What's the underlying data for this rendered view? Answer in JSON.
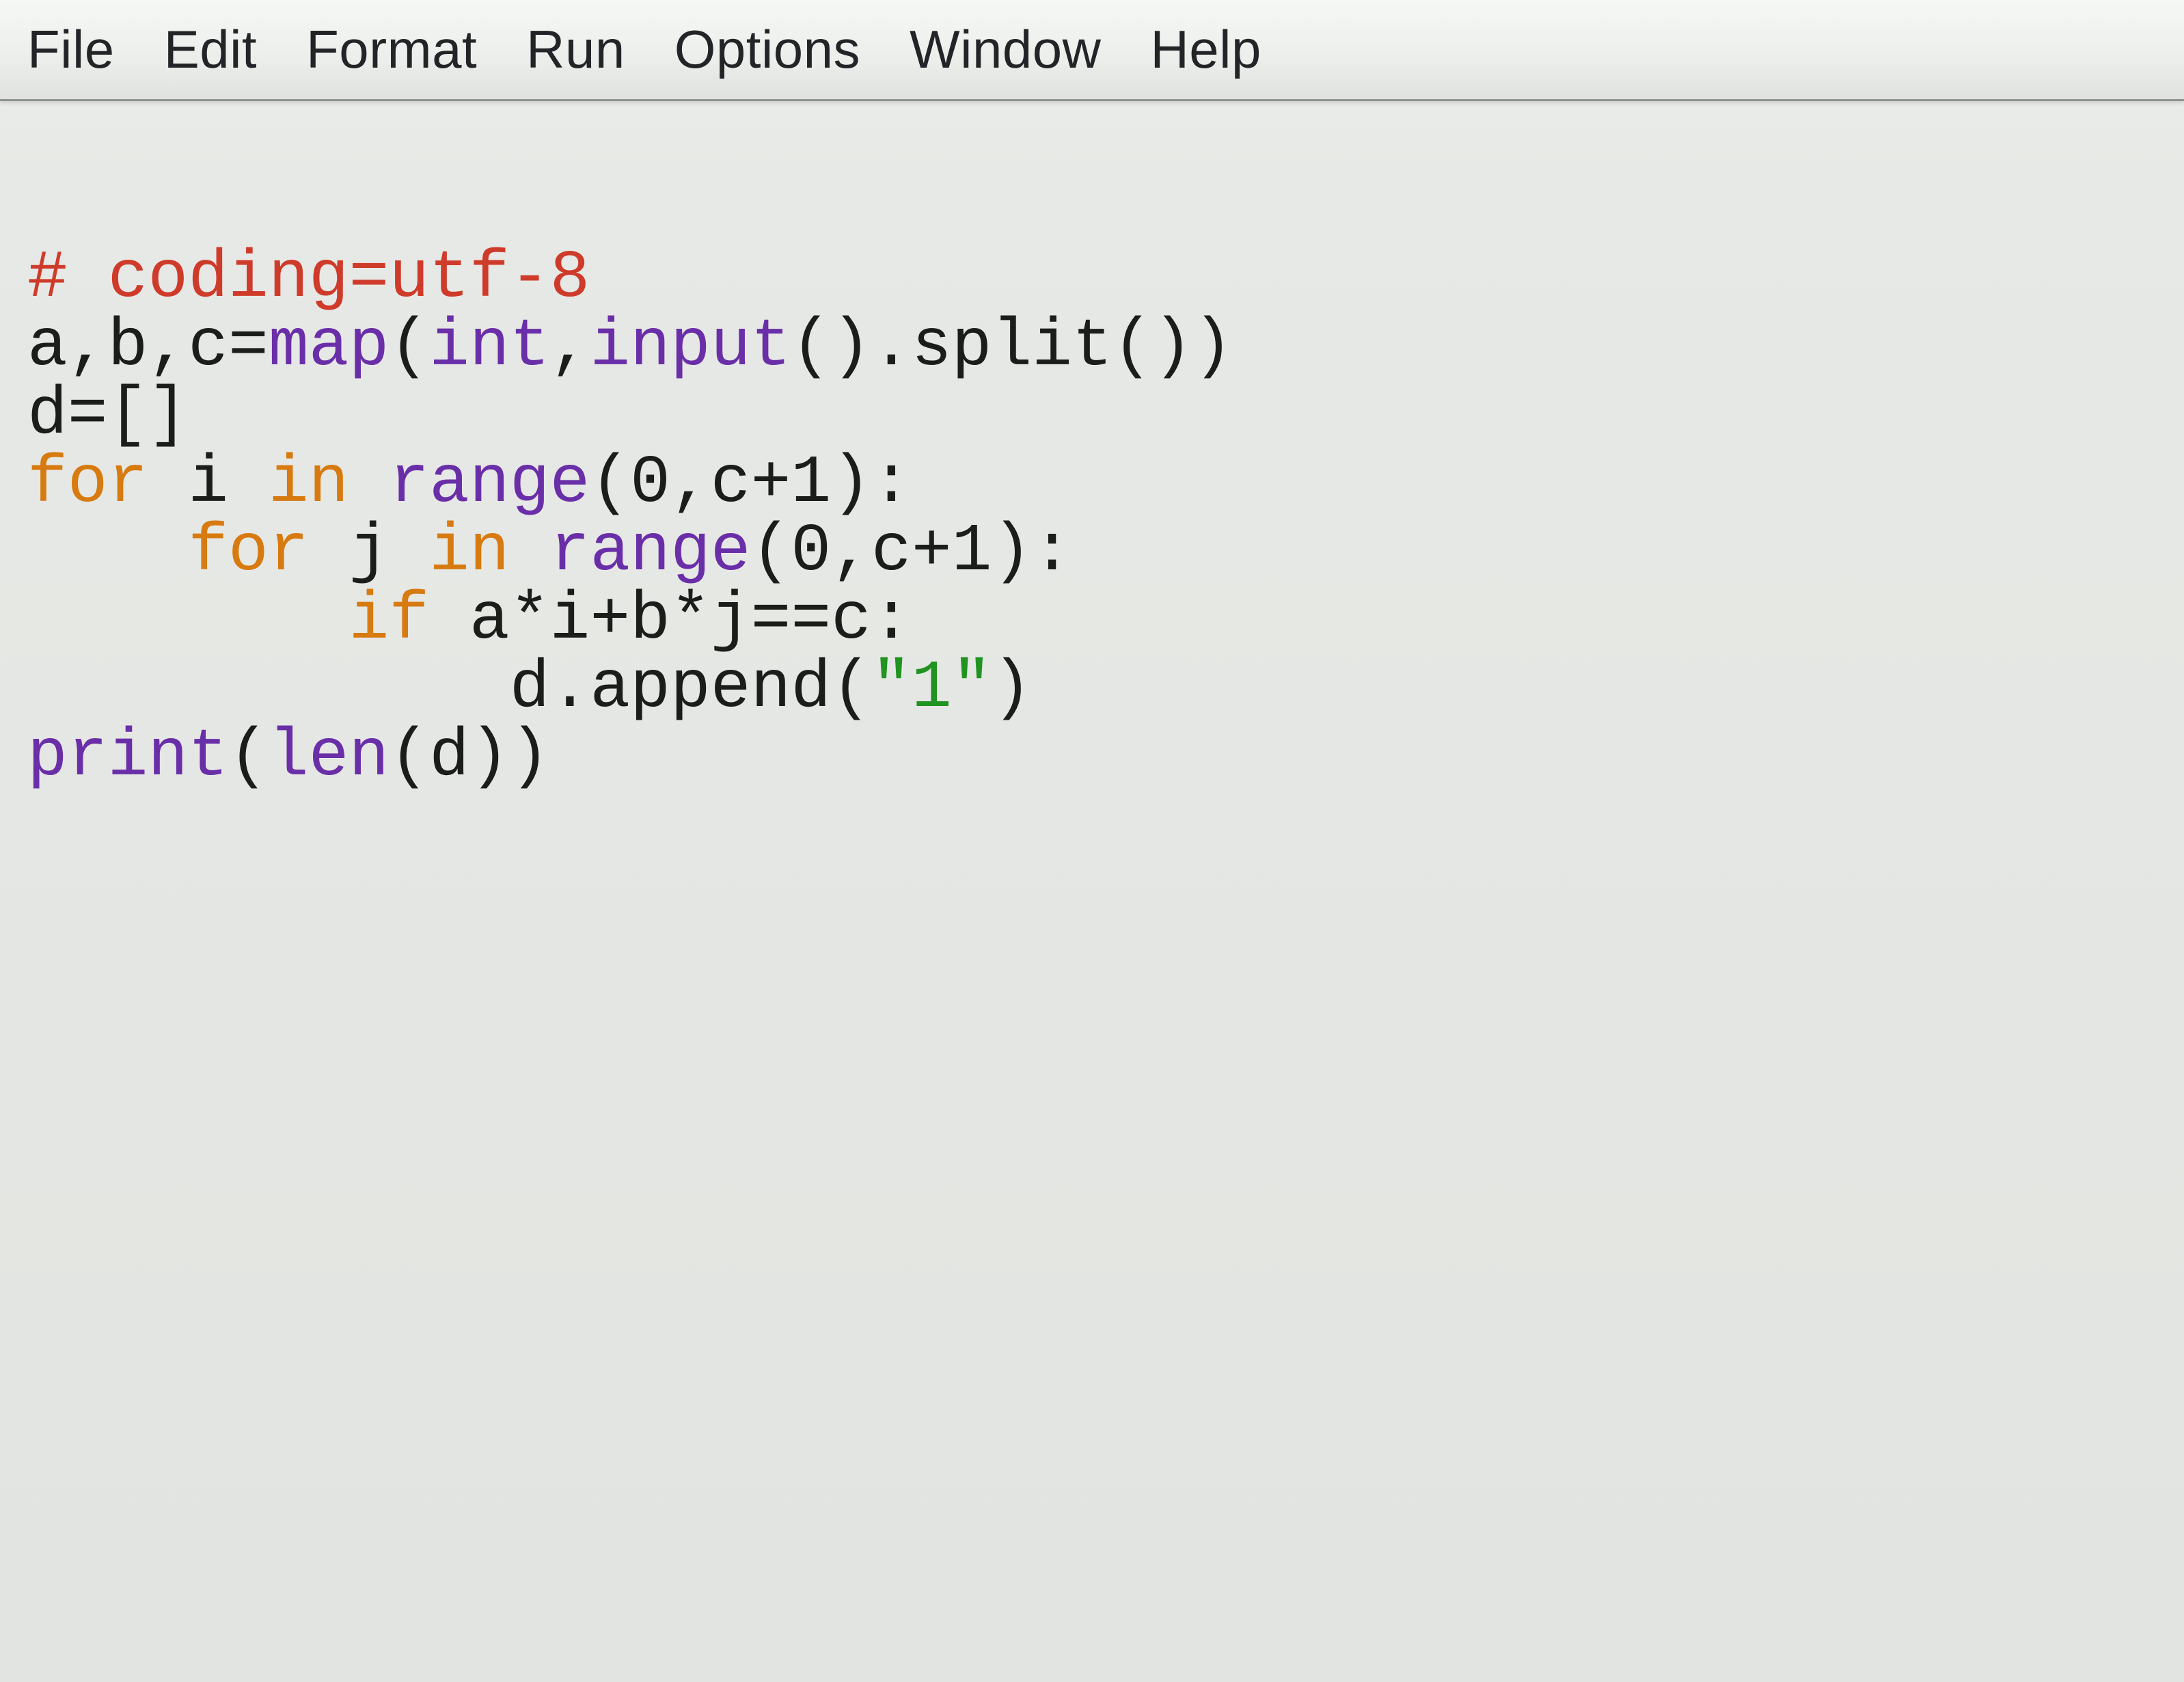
{
  "menubar": {
    "items": [
      "File",
      "Edit",
      "Format",
      "Run",
      "Options",
      "Window",
      "Help"
    ]
  },
  "code": {
    "lines": [
      {
        "indent": 0,
        "tokens": [
          {
            "cls": "c-comment",
            "t": "# coding=utf-8"
          }
        ]
      },
      {
        "indent": 0,
        "tokens": [
          {
            "cls": "c-plain",
            "t": "a,b,c="
          },
          {
            "cls": "c-builtin",
            "t": "map"
          },
          {
            "cls": "c-plain",
            "t": "("
          },
          {
            "cls": "c-builtin",
            "t": "int"
          },
          {
            "cls": "c-plain",
            "t": ","
          },
          {
            "cls": "c-builtin",
            "t": "input"
          },
          {
            "cls": "c-plain",
            "t": "().split())"
          }
        ]
      },
      {
        "indent": 0,
        "tokens": [
          {
            "cls": "c-plain",
            "t": "d=[]"
          }
        ]
      },
      {
        "indent": 0,
        "tokens": [
          {
            "cls": "c-keyword",
            "t": "for"
          },
          {
            "cls": "c-plain",
            "t": " i "
          },
          {
            "cls": "c-keyword",
            "t": "in"
          },
          {
            "cls": "c-plain",
            "t": " "
          },
          {
            "cls": "c-builtin",
            "t": "range"
          },
          {
            "cls": "c-plain",
            "t": "(0,c+1):"
          }
        ]
      },
      {
        "indent": 1,
        "tokens": [
          {
            "cls": "c-keyword",
            "t": "for"
          },
          {
            "cls": "c-plain",
            "t": " j "
          },
          {
            "cls": "c-keyword",
            "t": "in"
          },
          {
            "cls": "c-plain",
            "t": " "
          },
          {
            "cls": "c-builtin",
            "t": "range"
          },
          {
            "cls": "c-plain",
            "t": "(0,c+1):"
          }
        ]
      },
      {
        "indent": 2,
        "tokens": [
          {
            "cls": "c-keyword",
            "t": "if"
          },
          {
            "cls": "c-plain",
            "t": " a*i+b*j==c:"
          }
        ]
      },
      {
        "indent": 3,
        "tokens": [
          {
            "cls": "c-plain",
            "t": "d.append("
          },
          {
            "cls": "c-string",
            "t": "\"1\""
          },
          {
            "cls": "c-plain",
            "t": ")"
          }
        ]
      },
      {
        "indent": 0,
        "tokens": [
          {
            "cls": "c-builtin",
            "t": "print"
          },
          {
            "cls": "c-plain",
            "t": "("
          },
          {
            "cls": "c-builtin",
            "t": "len"
          },
          {
            "cls": "c-plain",
            "t": "(d))"
          }
        ]
      }
    ],
    "indent_unit": "    "
  }
}
